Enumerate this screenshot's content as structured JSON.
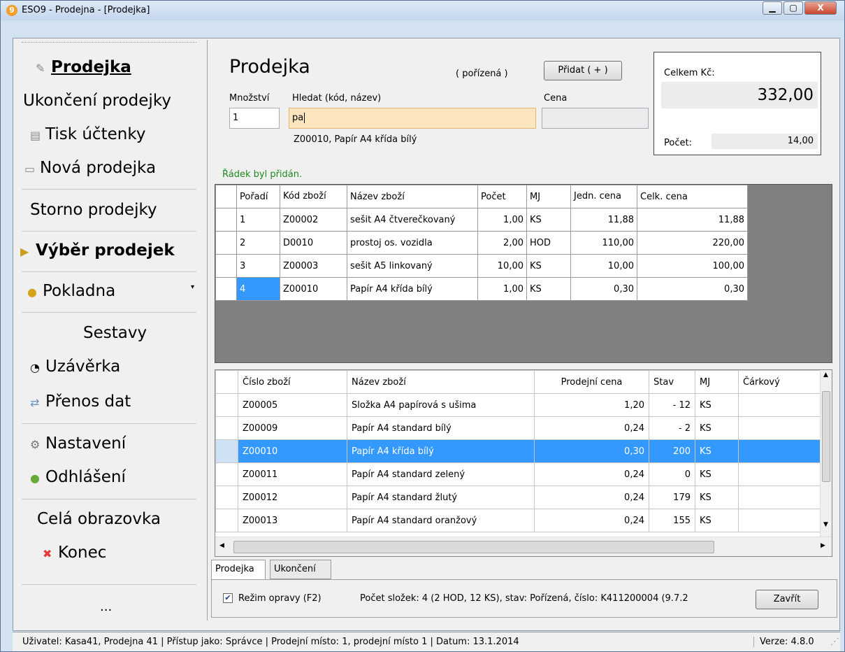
{
  "window": {
    "title": "ESO9 - Prodejna - [Prodejka]"
  },
  "sidebar": {
    "items": [
      {
        "label": "Prodejka"
      },
      {
        "label": "Ukončení prodejky"
      },
      {
        "label": "Tisk účtenky"
      },
      {
        "label": "Nová prodejka"
      },
      {
        "label": "Storno prodejky"
      },
      {
        "label": "Výběr prodejek"
      },
      {
        "label": "Pokladna"
      },
      {
        "label": "Sestavy"
      },
      {
        "label": "Uzávěrka"
      },
      {
        "label": "Přenos dat"
      },
      {
        "label": "Nastavení"
      },
      {
        "label": "Odhlášení"
      },
      {
        "label": "Celá obrazovka"
      },
      {
        "label": "Konec"
      },
      {
        "label": "..."
      }
    ]
  },
  "form": {
    "heading": "Prodejka",
    "state": "( pořízená )",
    "add_button": "Přidat  ( + )",
    "qty_label": "Množství",
    "qty_value": "1",
    "search_label": "Hledat (kód, název)",
    "search_value": "pa",
    "suggestion": "Z00010, Papír A4 křída bílý",
    "price_label": "Cena",
    "price_value": "",
    "message": "Řádek byl přidán."
  },
  "totals": {
    "label": "Celkem Kč:",
    "value": "332,00",
    "count_label": "Počet:",
    "count_value": "14,00"
  },
  "lines_table": {
    "columns": [
      "Pořadí",
      "Kód zboží",
      "Název zboží",
      "Počet",
      "MJ",
      "Jedn. cena",
      "Celk. cena"
    ],
    "rows": [
      [
        "1",
        "Z00002",
        "sešit A4 čtverečkovaný",
        "1,00",
        "KS",
        "11,88",
        "11,88"
      ],
      [
        "2",
        "D0010",
        "prostoj os. vozidla",
        "2,00",
        "HOD",
        "110,00",
        "220,00"
      ],
      [
        "3",
        "Z00003",
        "sešit A5 linkovaný",
        "10,00",
        "KS",
        "10,00",
        "100,00"
      ],
      [
        "4",
        "Z00010",
        "Papír A4 křída bílý",
        "1,00",
        "KS",
        "0,30",
        "0,30"
      ]
    ]
  },
  "goods_table": {
    "columns": [
      "Číslo zboží",
      "Název zboží",
      "Prodejní cena",
      "Stav",
      "MJ",
      "Čárkový"
    ],
    "rows": [
      [
        "Z00005",
        "Složka A4 papírová s ušima",
        "1,20",
        "- 12",
        "KS",
        ""
      ],
      [
        "Z00009",
        "Papír A4 standard bílý",
        "0,24",
        "- 2",
        "KS",
        ""
      ],
      [
        "Z00010",
        "Papír A4 křída bílý",
        "0,30",
        "200",
        "KS",
        ""
      ],
      [
        "Z00011",
        "Papír A4 standard zelený",
        "0,24",
        "0",
        "KS",
        ""
      ],
      [
        "Z00012",
        "Papír A4 standard žlutý",
        "0,24",
        "179",
        "KS",
        ""
      ],
      [
        "Z00013",
        "Papír A4 standard oranžový",
        "0,24",
        "155",
        "KS",
        ""
      ]
    ]
  },
  "tabs": [
    "Prodejka",
    "Ukončení"
  ],
  "footer": {
    "checkbox_label": "Režim opravy (F2)",
    "info": "Počet složek: 4  (2 HOD, 12 KS),  stav: Pořízená,  číslo: K411200004  (9.7.2",
    "close_button": "Zavřít"
  },
  "statusbar": {
    "text": "Uživatel: Kasa41, Prodejna 41  |  Přístup jako: Správce  |  Prodejní místo: 1, prodejní místo 1  |  Datum: 13.1.2014",
    "version": "Verze: 4.8.0"
  }
}
